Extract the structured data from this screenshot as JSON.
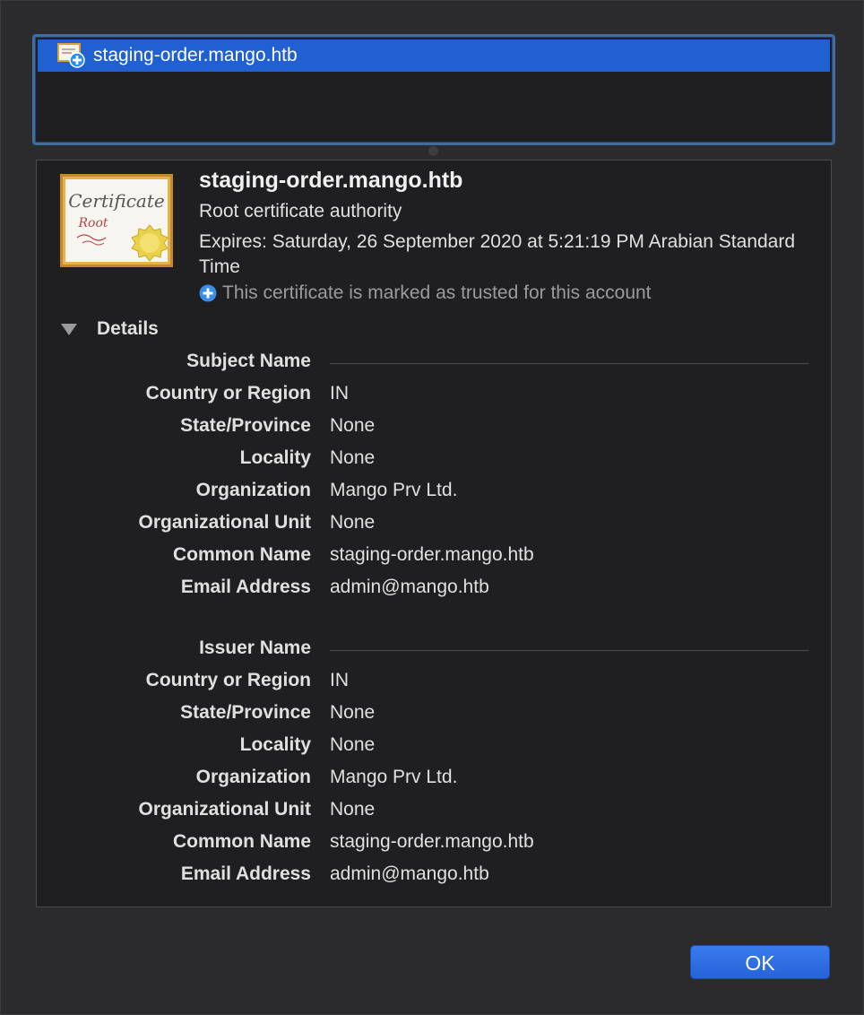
{
  "certificate_list": {
    "items": [
      {
        "label": "staging-order.mango.htb",
        "selected": true
      }
    ]
  },
  "certificate": {
    "title": "staging-order.mango.htb",
    "subtitle": "Root certificate authority",
    "expires": "Expires: Saturday, 26 September 2020 at 5:21:19 PM Arabian Standard Time",
    "trust_text": "This certificate is marked as trusted for this account",
    "image_icon": "certificate-root-icon",
    "image_text_title": "Certificate",
    "image_text_sub": "Root"
  },
  "details": {
    "toggle_label": "Details",
    "expanded": true,
    "subject": {
      "header": "Subject Name",
      "fields": [
        {
          "label": "Country or Region",
          "value": "IN"
        },
        {
          "label": "State/Province",
          "value": "None"
        },
        {
          "label": "Locality",
          "value": "None"
        },
        {
          "label": "Organization",
          "value": "Mango Prv Ltd."
        },
        {
          "label": "Organizational Unit",
          "value": "None"
        },
        {
          "label": "Common Name",
          "value": "staging-order.mango.htb"
        },
        {
          "label": "Email Address",
          "value": "admin@mango.htb"
        }
      ]
    },
    "issuer": {
      "header": "Issuer Name",
      "fields": [
        {
          "label": "Country or Region",
          "value": "IN"
        },
        {
          "label": "State/Province",
          "value": "None"
        },
        {
          "label": "Locality",
          "value": "None"
        },
        {
          "label": "Organization",
          "value": "Mango Prv Ltd."
        },
        {
          "label": "Organizational Unit",
          "value": "None"
        },
        {
          "label": "Common Name",
          "value": "staging-order.mango.htb"
        },
        {
          "label": "Email Address",
          "value": "admin@mango.htb"
        }
      ]
    }
  },
  "buttons": {
    "ok_label": "OK"
  },
  "colors": {
    "selection": "#2160d1",
    "accent_blue": "#3a8ee6",
    "cert_gold": "#d9a23a"
  }
}
